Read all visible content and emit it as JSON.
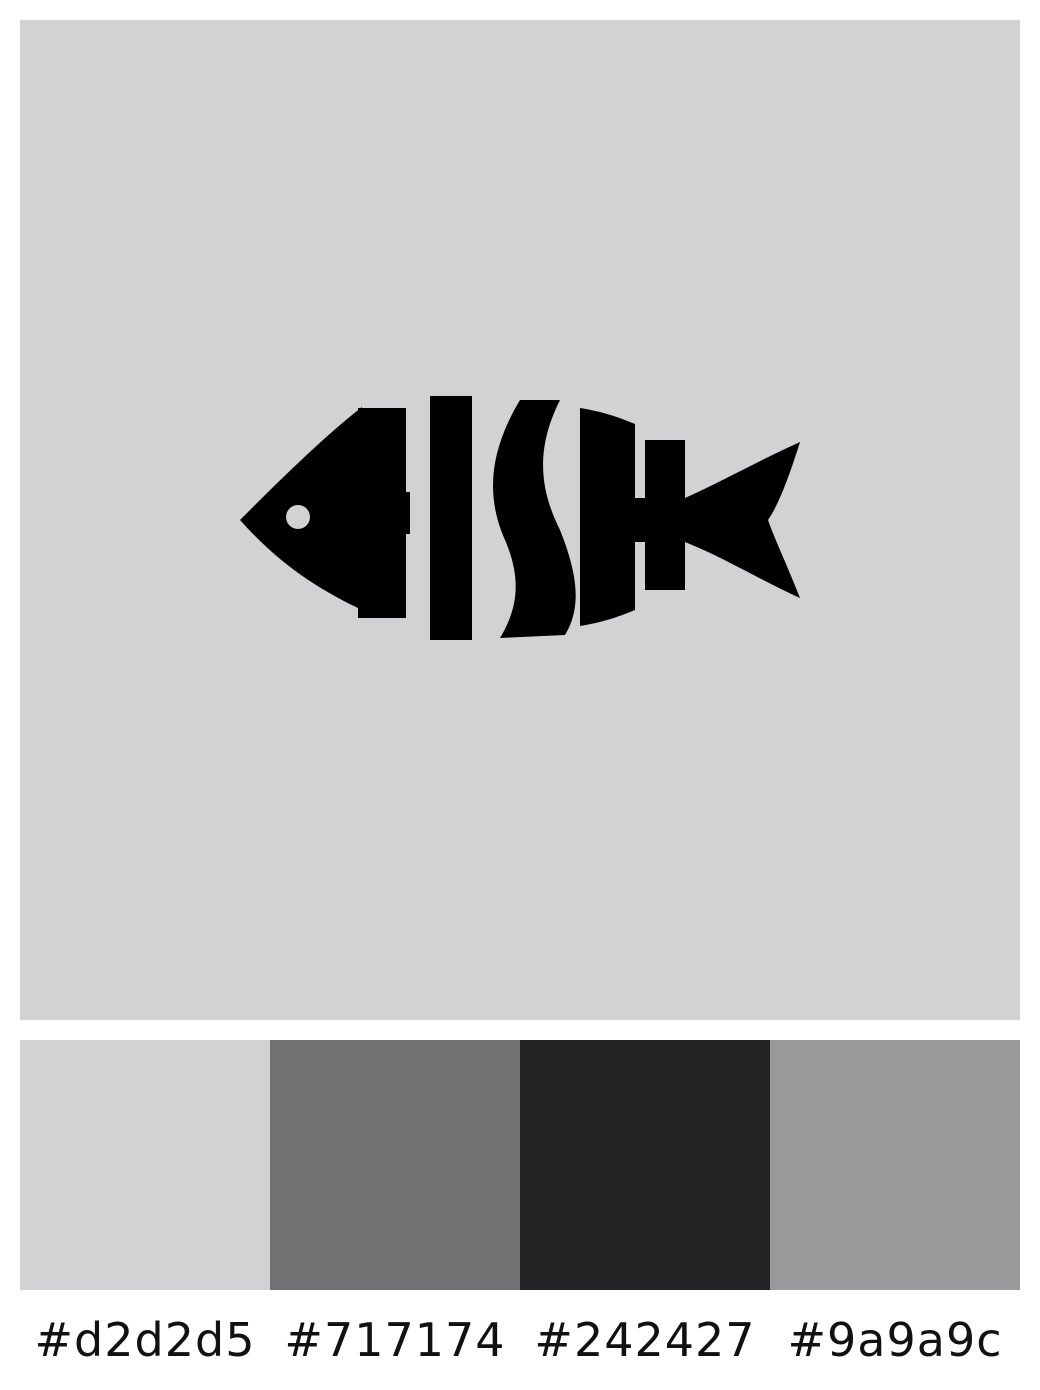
{
  "artwork": {
    "logo_text": "FISH",
    "background_color": "#d2d2d5",
    "ink_color": "#000000"
  },
  "palette": {
    "swatches": [
      {
        "hex": "#d2d2d5",
        "label": "#d2d2d5"
      },
      {
        "hex": "#717174",
        "label": "#717174"
      },
      {
        "hex": "#242427",
        "label": "#242427"
      },
      {
        "hex": "#9a9a9c",
        "label": "#9a9a9c"
      }
    ]
  }
}
